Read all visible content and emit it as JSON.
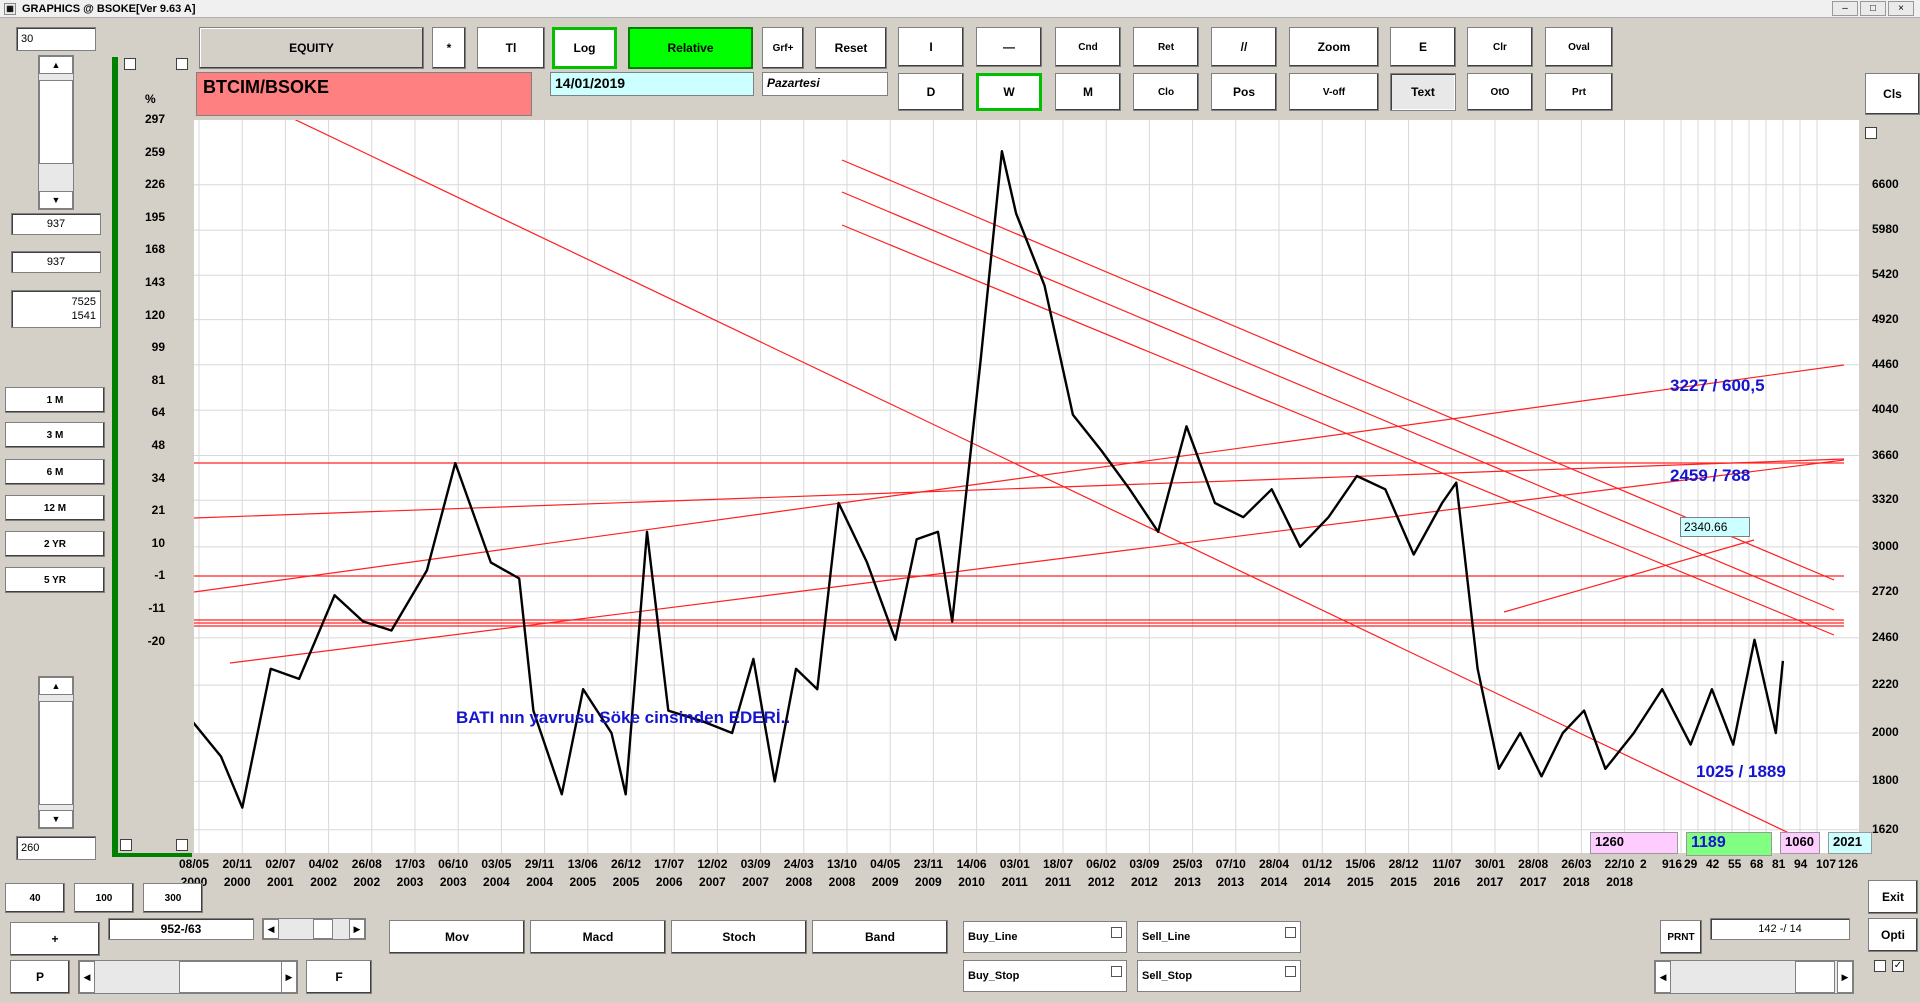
{
  "window": {
    "title": "GRAPHICS  @ BSOKE[Ver 9.63 A]"
  },
  "left": {
    "top_value": "30",
    "field1": "937",
    "field2": "937",
    "field3_line1": "7525",
    "field3_line2": "1541",
    "periods": [
      "1 M",
      "3 M",
      "6 M",
      "12 M",
      "2 YR",
      "5 YR"
    ],
    "bottom_value": "260"
  },
  "toolbar": {
    "row1": [
      "EQUITY",
      "*",
      "Tl",
      "Log",
      "Relative",
      "Grf+",
      "Reset",
      "I",
      "—",
      "Cnd",
      "Ret",
      "//",
      "Zoom",
      "E",
      "Clr",
      "Oval"
    ],
    "row2": [
      "D",
      "W",
      "M",
      "Clo",
      "Pos",
      "V-off",
      "Text",
      "OtO",
      "Prt"
    ],
    "cls": "Cls"
  },
  "info": {
    "symbol": "BTCIM/BSOKE",
    "date": "14/01/2019",
    "day": "Pazartesi"
  },
  "chart_data": {
    "type": "line",
    "title": "BTCIM/BSOKE",
    "scale": "log",
    "ylabel": "%",
    "left_axis_ticks": [
      "297",
      "259",
      "226",
      "195",
      "168",
      "143",
      "120",
      "99",
      "81",
      "64",
      "48",
      "34",
      "21",
      "10",
      "-1",
      "-11",
      "-20"
    ],
    "right_axis_ticks": [
      "6600",
      "5980",
      "5420",
      "4920",
      "4460",
      "4040",
      "3660",
      "3320",
      "3000",
      "2720",
      "2460",
      "2220",
      "2000",
      "1800",
      "1620"
    ],
    "x_tick_dates": [
      "08/05",
      "20/11",
      "02/07",
      "04/02",
      "26/08",
      "17/03",
      "06/10",
      "03/05",
      "29/11",
      "13/06",
      "26/12",
      "17/07",
      "12/02",
      "03/09",
      "24/03",
      "13/10",
      "04/05",
      "23/11",
      "14/06",
      "03/01",
      "18/07",
      "06/02",
      "03/09",
      "25/03",
      "07/10",
      "28/04",
      "01/12",
      "15/06",
      "28/12",
      "11/07",
      "30/01",
      "28/08",
      "26/03",
      "22/10"
    ],
    "x_tick_years": [
      "2000",
      "2000",
      "2001",
      "2002",
      "2002",
      "2003",
      "2003",
      "2004",
      "2004",
      "2005",
      "2005",
      "2006",
      "2007",
      "2007",
      "2008",
      "2008",
      "2009",
      "2009",
      "2010",
      "2011",
      "2011",
      "2012",
      "2012",
      "2013",
      "2013",
      "2014",
      "2014",
      "2015",
      "2015",
      "2016",
      "2017",
      "2017",
      "2018",
      "2018"
    ],
    "x_tick_extra": [
      "2",
      "916",
      "29",
      "42",
      "55",
      "68",
      "81",
      "94",
      "107",
      "126"
    ],
    "ylim": [
      1540,
      7600
    ],
    "series": [
      {
        "values": [
          [
            "2000-05",
            2050
          ],
          [
            "2000-09",
            1900
          ],
          [
            "2000-12",
            1700
          ],
          [
            "2001-04",
            2300
          ],
          [
            "2001-08",
            2250
          ],
          [
            "2002-01",
            2700
          ],
          [
            "2002-05",
            2550
          ],
          [
            "2002-09",
            2500
          ],
          [
            "2003-02",
            2850
          ],
          [
            "2003-06",
            3600
          ],
          [
            "2003-11",
            2900
          ],
          [
            "2004-03",
            2800
          ],
          [
            "2004-05",
            2100
          ],
          [
            "2004-09",
            1750
          ],
          [
            "2004-12",
            2200
          ],
          [
            "2005-04",
            2000
          ],
          [
            "2005-06",
            1750
          ],
          [
            "2005-09",
            3100
          ],
          [
            "2005-12",
            2100
          ],
          [
            "2006-05",
            2050
          ],
          [
            "2006-09",
            2000
          ],
          [
            "2006-12",
            2350
          ],
          [
            "2007-03",
            1800
          ],
          [
            "2007-06",
            2300
          ],
          [
            "2007-09",
            2200
          ],
          [
            "2007-12",
            3300
          ],
          [
            "2008-04",
            2900
          ],
          [
            "2008-08",
            2450
          ],
          [
            "2008-11",
            3050
          ],
          [
            "2009-02",
            3100
          ],
          [
            "2009-04",
            2550
          ],
          [
            "2009-08",
            4500
          ],
          [
            "2009-11",
            7100
          ],
          [
            "2010-01",
            6200
          ],
          [
            "2010-05",
            5300
          ],
          [
            "2010-09",
            4000
          ],
          [
            "2011-01",
            3700
          ],
          [
            "2011-05",
            3400
          ],
          [
            "2011-09",
            3100
          ],
          [
            "2012-01",
            3900
          ],
          [
            "2012-05",
            3300
          ],
          [
            "2012-09",
            3200
          ],
          [
            "2013-01",
            3400
          ],
          [
            "2013-05",
            3000
          ],
          [
            "2013-09",
            3200
          ],
          [
            "2014-01",
            3500
          ],
          [
            "2014-05",
            3400
          ],
          [
            "2014-09",
            2950
          ],
          [
            "2015-01",
            3300
          ],
          [
            "2015-03",
            3450
          ],
          [
            "2015-06",
            2300
          ],
          [
            "2015-09",
            1850
          ],
          [
            "2015-12",
            2000
          ],
          [
            "2016-03",
            1820
          ],
          [
            "2016-06",
            2000
          ],
          [
            "2016-09",
            2100
          ],
          [
            "2016-12",
            1850
          ],
          [
            "2017-04",
            2000
          ],
          [
            "2017-08",
            2200
          ],
          [
            "2017-12",
            1950
          ],
          [
            "2018-03",
            2200
          ],
          [
            "2018-06",
            1950
          ],
          [
            "2018-09",
            2450
          ],
          [
            "2018-12",
            2000
          ],
          [
            "2019-01",
            2340
          ]
        ]
      }
    ],
    "annotations": [
      "3227 / 600,5",
      "2459 / 788",
      "1025 / 1889",
      "BATI nın  yavrusu  Söke cinsinden EDERİ.."
    ],
    "current_value": "2340.66"
  },
  "bottom_boxes": {
    "pink1": "1260",
    "green": "1189",
    "pink2": "1060",
    "blue": "2021"
  },
  "bottom": {
    "zoom_btns": [
      "40",
      "100",
      "300"
    ],
    "plus": "+",
    "counter": "952-/63",
    "p": "P",
    "f": "F",
    "indicators": [
      "Mov",
      "Macd",
      "Stoch",
      "Band"
    ],
    "buy_line": "Buy_Line",
    "sell_line": "Sell_Line",
    "buy_stop": "Buy_Stop",
    "sell_stop": "Sell_Stop",
    "prnt": "PRNT",
    "ratio": "142 -/ 14",
    "exit": "Exit",
    "opti": "Opti"
  },
  "colors": {
    "green_frame": "#008000",
    "trend_line": "#ff2020",
    "annotation": "#1515d0",
    "symbol_box": "#ff8080",
    "date_box": "#ccffff"
  }
}
